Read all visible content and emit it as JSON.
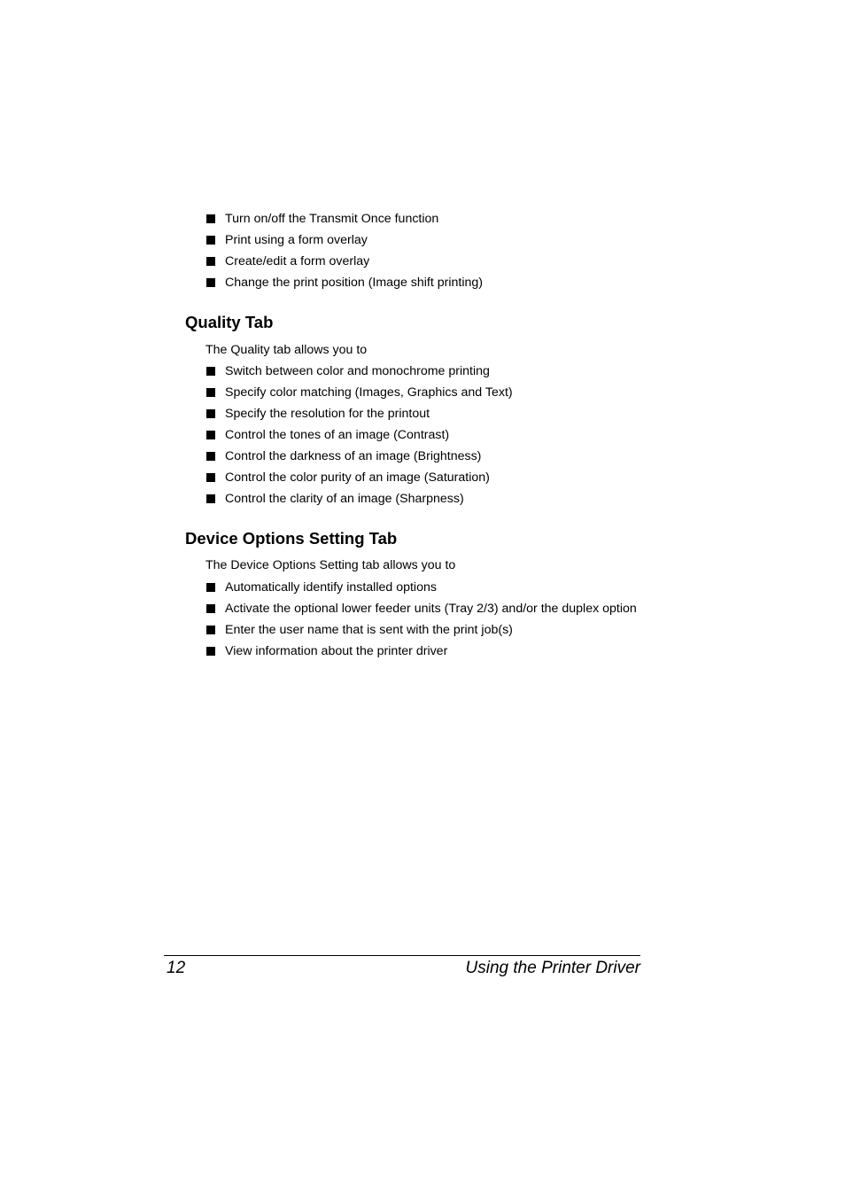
{
  "intro_list": [
    "Turn on/off the Transmit Once function",
    "Print using a form overlay",
    "Create/edit a form overlay",
    "Change the print position (Image shift printing)"
  ],
  "quality": {
    "heading": "Quality Tab",
    "intro": "The Quality tab allows you to",
    "items": [
      "Switch between color and monochrome printing",
      "Specify color matching (Images, Graphics and Text)",
      "Specify the resolution for the printout",
      "Control the tones of an image (Contrast)",
      "Control the darkness of an image (Brightness)",
      "Control the color purity of an image (Saturation)",
      "Control the clarity of an image (Sharpness)"
    ]
  },
  "device_options": {
    "heading": "Device Options Setting Tab",
    "intro": "The Device Options Setting tab allows you to",
    "items": [
      "Automatically identify installed options",
      "Activate the optional lower feeder units (Tray 2/3) and/or the duplex option",
      "Enter the user name that is sent with the print job(s)",
      "View information about the printer driver"
    ]
  },
  "footer": {
    "page_number": "12",
    "chapter_title": "Using the Printer Driver"
  }
}
